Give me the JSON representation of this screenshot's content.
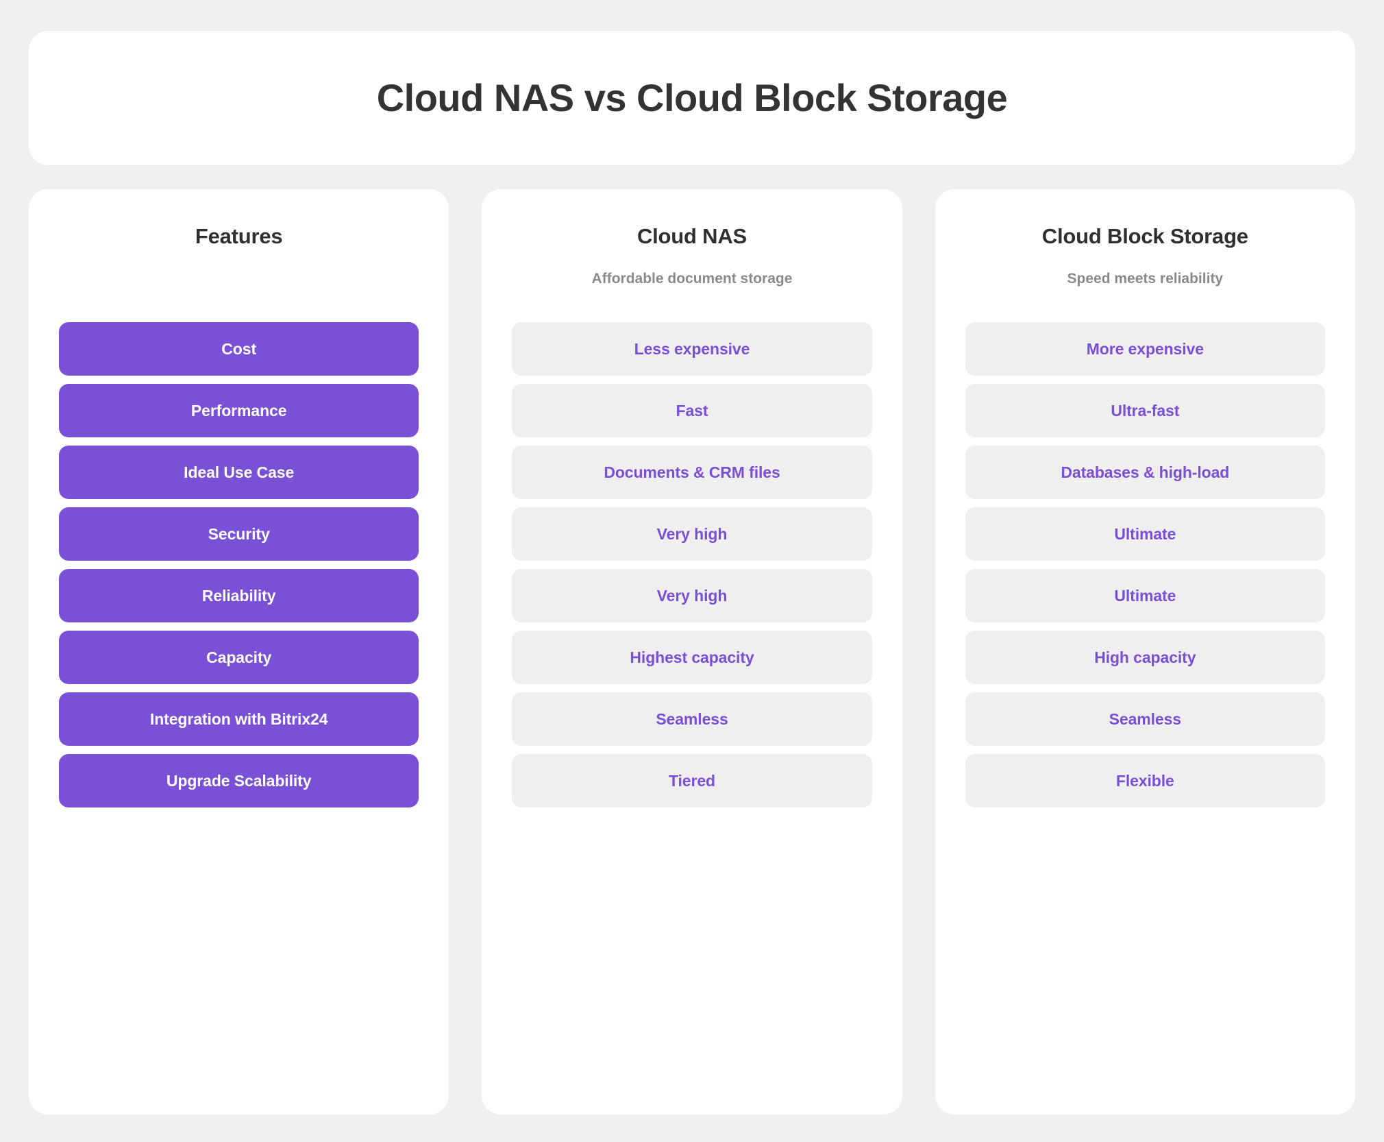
{
  "title": "Cloud NAS vs Cloud Block Storage",
  "colors": {
    "page_background": "#f0f0f0",
    "card_background": "#ffffff",
    "feature_chip": "#7950d6",
    "feature_chip_text": "#ffffff",
    "value_chip": "#efefef",
    "value_chip_text": "#7a4ed6",
    "heading_text": "#2f2f2f",
    "subtitle_text": "#8a8a8a"
  },
  "columns": [
    {
      "title": "Features",
      "subtitle": "",
      "chip_style": "feature",
      "rows": [
        "Cost",
        "Performance",
        "Ideal Use Case",
        "Security",
        "Reliability",
        "Capacity",
        "Integration with Bitrix24",
        "Upgrade Scalability"
      ]
    },
    {
      "title": "Cloud NAS",
      "subtitle": "Affordable document storage",
      "chip_style": "value",
      "rows": [
        "Less expensive",
        "Fast",
        "Documents & CRM files",
        "Very high",
        "Very high",
        "Highest capacity",
        "Seamless",
        "Tiered"
      ]
    },
    {
      "title": "Cloud Block Storage",
      "subtitle": "Speed meets reliability",
      "chip_style": "value",
      "rows": [
        "More expensive",
        "Ultra-fast",
        "Databases & high-load",
        "Ultimate",
        "Ultimate",
        "High capacity",
        "Seamless",
        "Flexible"
      ]
    }
  ]
}
